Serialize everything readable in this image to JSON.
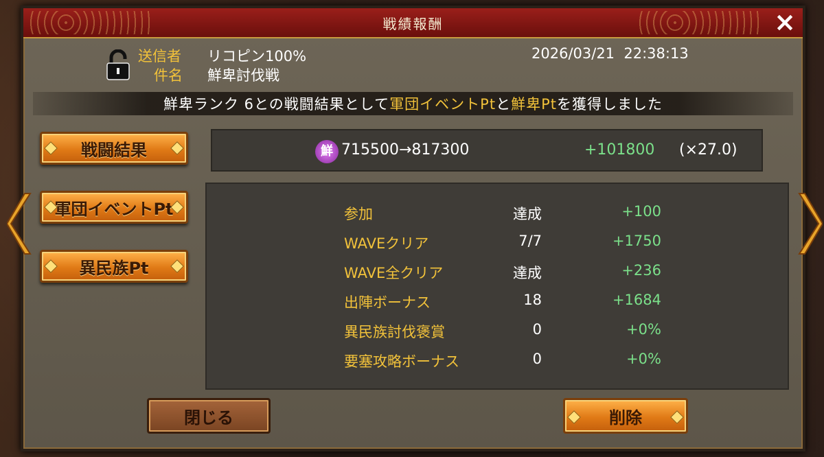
{
  "window": {
    "title": "戦績報酬",
    "close_icon": "×"
  },
  "mail": {
    "sender_label": "送信者",
    "sender": "リコピン100%",
    "subject_label": "件名",
    "subject": "鮮卑討伐戦",
    "datetime": "2026/03/21  22:38:13"
  },
  "banner": {
    "part1": "鮮卑ランク 6との戦闘結果として",
    "hl1": "軍団イベントPt",
    "part2": "と",
    "hl2": "鮮卑Pt",
    "part3": "を獲得しました"
  },
  "tabs": [
    "戦闘結果",
    "軍団イベントPt",
    "異民族Pt"
  ],
  "points": {
    "icon_char": "鮮",
    "change": "715500→817300",
    "gain": "+101800",
    "multiplier": "(×27.0)"
  },
  "details": [
    {
      "label": "参加",
      "value": "達成",
      "gain": "+100"
    },
    {
      "label": "WAVEクリア",
      "value": "7/7",
      "gain": "+1750"
    },
    {
      "label": "WAVE全クリア",
      "value": "達成",
      "gain": "+236"
    },
    {
      "label": "出陣ボーナス",
      "value": "18",
      "gain": "+1684"
    },
    {
      "label": "異民族討伐褒賞",
      "value": "0",
      "gain": "+0%"
    },
    {
      "label": "要塞攻略ボーナス",
      "value": "0",
      "gain": "+0%"
    }
  ],
  "buttons": {
    "close": "閉じる",
    "delete": "削除"
  },
  "colors": {
    "accent": "#f2c23a",
    "gain": "#7be08a",
    "title_bar": "#8a1a16"
  }
}
